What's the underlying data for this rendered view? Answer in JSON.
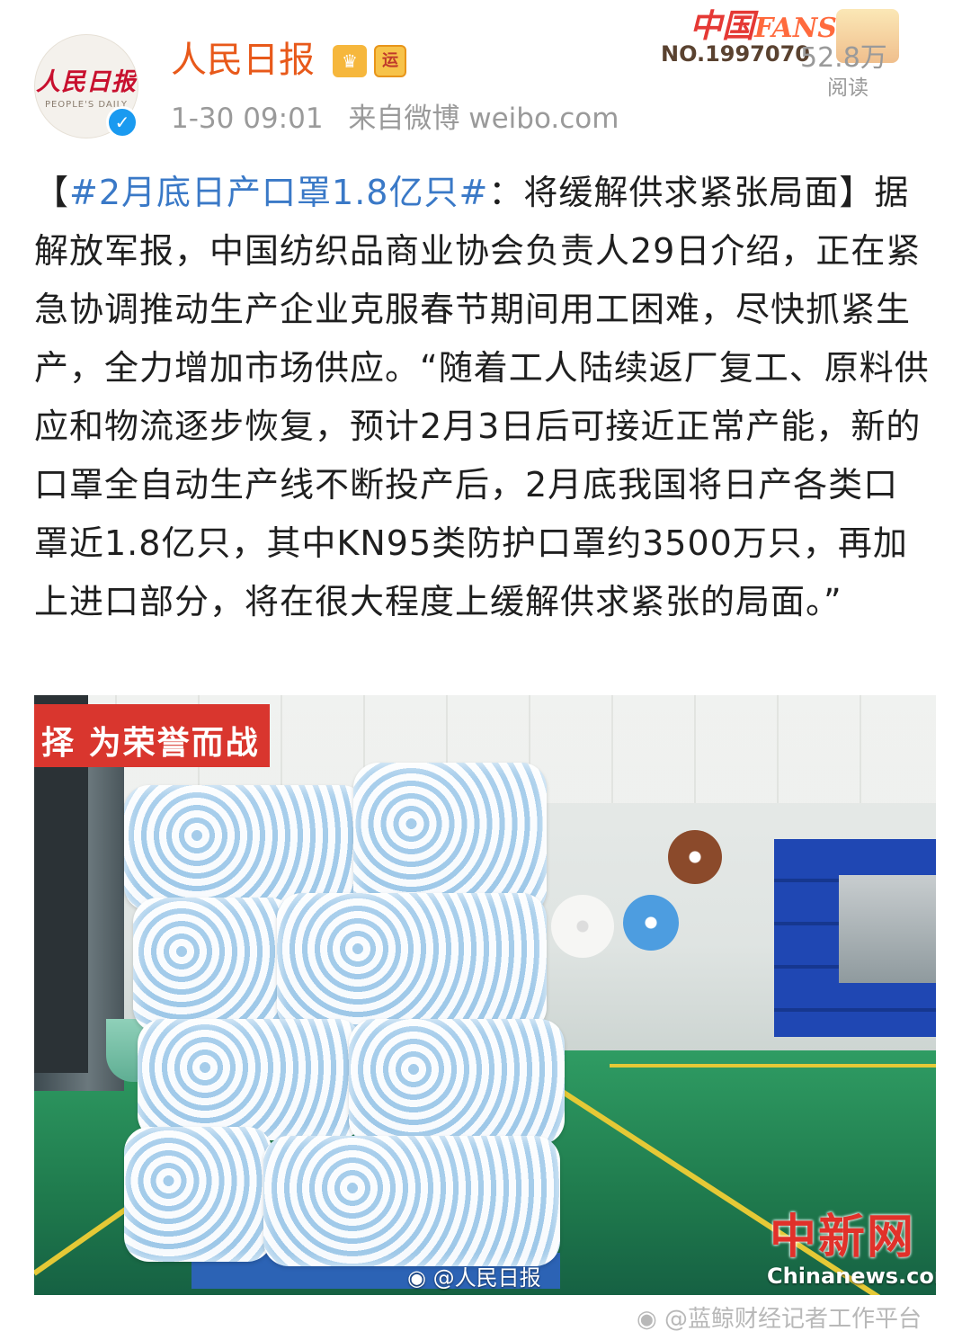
{
  "header": {
    "avatar_logo": "人民日报",
    "avatar_subtitle": "PEOPLE'S DAILY",
    "username": "人民日报",
    "badge_crown_icon": "crown-icon",
    "badge_yun": "运",
    "verified_icon": "check-icon",
    "time": "1-30 09:01",
    "source": "来自微博 weibo.com"
  },
  "fans_badge": {
    "title": "中国",
    "title_en": "FANS",
    "number": "NO.1997070",
    "reads": "52.8万",
    "reads_label": "阅读"
  },
  "post": {
    "hashtag": "#2月底日产口罩1.8亿只#",
    "bracket_open": "【",
    "headline_rest": "：将缓解供求紧张局面】",
    "body": "据解放军报，中国纺织品商业协会负责人29日介绍，正在紧急协调推动生产企业克服春节期间用工困难，尽快抓紧生产，全力增加市场供应。“随着工人陆续返厂复工、原料供应和物流逐步恢复，预计2月3日后可接近正常产能，新的口罩全自动生产线不断投产后，2月底我国将日产各类口罩近1.8亿只，其中KN95类防护口罩约3500万只，再加上进口部分，将在很大程度上缓解供求紧张的局面。”"
  },
  "photo": {
    "banner_text": "为荣誉而战",
    "banner_prefix": "择",
    "weibo_watermark": "@人民日报",
    "chinanews_logo": "中新网",
    "chinanews_url": "Chinanews.com"
  },
  "footer": {
    "watermark": "@蓝鲸财经记者工作平台"
  },
  "colors": {
    "username": "#e8591a",
    "hashtag": "#3a79c7",
    "verified": "#1a9af0",
    "floor": "#2f9c63"
  }
}
